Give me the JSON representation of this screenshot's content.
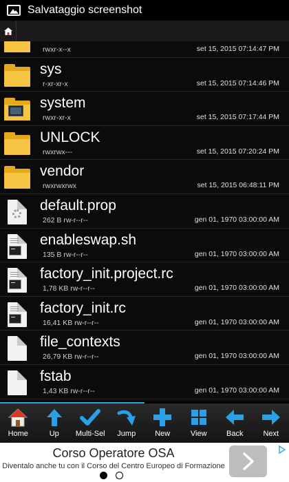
{
  "status_bar": {
    "title": "Salvataggio screenshot"
  },
  "files": [
    {
      "name": "",
      "meta": "rwxr-x--x",
      "date": "set 15, 2015 07:14:47 PM",
      "icon": "folder-icon"
    },
    {
      "name": "sys",
      "meta": "r-xr-xr-x",
      "date": "set 15, 2015 07:14:46 PM",
      "icon": "folder-icon"
    },
    {
      "name": "system",
      "meta": "rwxr-xr-x",
      "date": "set 15, 2015 07:17:44 PM",
      "icon": "system-folder-icon"
    },
    {
      "name": "UNLOCK",
      "meta": "rwxrwx---",
      "date": "set 15, 2015 07:20:24 PM",
      "icon": "folder-icon"
    },
    {
      "name": "vendor",
      "meta": "rwxrwxrwx",
      "date": "set 15, 2015 06:48:11 PM",
      "icon": "folder-icon"
    },
    {
      "name": "default.prop",
      "meta": "262 B rw-r--r--",
      "date": "gen 01, 1970 03:00:00 AM",
      "icon": "settings-file-icon"
    },
    {
      "name": "enableswap.sh",
      "meta": "135 B rw-r--r--",
      "date": "gen 01, 1970 03:00:00 AM",
      "icon": "script-file-icon"
    },
    {
      "name": "factory_init.project.rc",
      "meta": "1,78 KB rw-r--r--",
      "date": "gen 01, 1970 03:00:00 AM",
      "icon": "script-file-icon"
    },
    {
      "name": "factory_init.rc",
      "meta": "16,41 KB rw-r--r--",
      "date": "gen 01, 1970 03:00:00 AM",
      "icon": "script-file-icon"
    },
    {
      "name": "file_contexts",
      "meta": "26,79 KB rw-r--r--",
      "date": "gen 01, 1970 03:00:00 AM",
      "icon": "blank-file-icon"
    },
    {
      "name": "fstab",
      "meta": "1,43 KB rw-r--r--",
      "date": "gen 01, 1970 03:00:00 AM",
      "icon": "blank-file-icon"
    }
  ],
  "toolbar": {
    "home": "Home",
    "up": "Up",
    "multi_sel": "Multi-Sel",
    "jump": "Jump",
    "new": "New",
    "view": "View",
    "back": "Back",
    "next": "Next"
  },
  "ad": {
    "title": "Corso Operatore OSA",
    "subtitle": "Diventalo anche tu con il Corso del Centro Europeo di Formazione"
  },
  "colors": {
    "accent": "#2aa8e0",
    "folder": "#f6c443",
    "toolbar_icon": "#2aa0e6"
  }
}
